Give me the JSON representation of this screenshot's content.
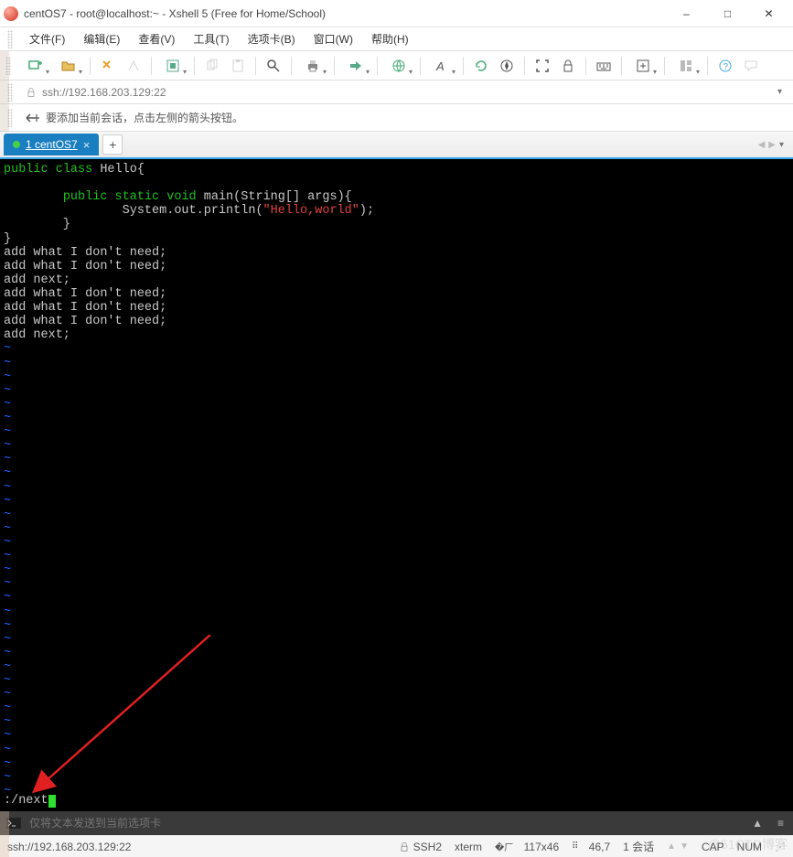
{
  "window": {
    "title": "centOS7 - root@localhost:~ - Xshell 5 (Free for Home/School)"
  },
  "menubar": {
    "items": [
      "文件(F)",
      "编辑(E)",
      "查看(V)",
      "工具(T)",
      "选项卡(B)",
      "窗口(W)",
      "帮助(H)"
    ]
  },
  "addressbar": {
    "url": "ssh://192.168.203.129:22"
  },
  "hintbar": {
    "text": "要添加当前会话，点击左侧的箭头按钮。"
  },
  "tab": {
    "label": "1 centOS7"
  },
  "terminal": {
    "lines": [
      {
        "t": "code",
        "segments": [
          [
            "kw-mod",
            "public"
          ],
          [
            "kw-plain",
            " "
          ],
          [
            "kw-mod",
            "class"
          ],
          [
            "kw-plain",
            " Hello{"
          ]
        ]
      },
      {
        "t": "blank"
      },
      {
        "t": "code",
        "segments": [
          [
            "kw-plain",
            "        "
          ],
          [
            "kw-mod",
            "public"
          ],
          [
            "kw-plain",
            " "
          ],
          [
            "kw-mod",
            "static"
          ],
          [
            "kw-plain",
            " "
          ],
          [
            "kw-mod",
            "void"
          ],
          [
            "kw-plain",
            " main(String[] args){"
          ]
        ]
      },
      {
        "t": "code",
        "segments": [
          [
            "kw-plain",
            "                System.out.println("
          ],
          [
            "str",
            "\"Hello,world\""
          ],
          [
            "kw-plain",
            ");"
          ]
        ]
      },
      {
        "t": "code",
        "segments": [
          [
            "kw-plain",
            "        }"
          ]
        ]
      },
      {
        "t": "code",
        "segments": [
          [
            "kw-plain",
            "}"
          ]
        ]
      },
      {
        "t": "code",
        "segments": [
          [
            "kw-plain",
            "add what I don't need;"
          ]
        ]
      },
      {
        "t": "code",
        "segments": [
          [
            "kw-plain",
            "add what I don't need;"
          ]
        ]
      },
      {
        "t": "code",
        "segments": [
          [
            "kw-plain",
            "add next;"
          ]
        ]
      },
      {
        "t": "code",
        "segments": [
          [
            "kw-plain",
            "add what I don't need;"
          ]
        ]
      },
      {
        "t": "code",
        "segments": [
          [
            "kw-plain",
            "add what I don't need;"
          ]
        ]
      },
      {
        "t": "code",
        "segments": [
          [
            "kw-plain",
            "add what I don't need;"
          ]
        ]
      },
      {
        "t": "code",
        "segments": [
          [
            "kw-plain",
            "add next;"
          ]
        ]
      }
    ],
    "tilde_count": 33,
    "command": ":/next"
  },
  "footer_input": {
    "placeholder": "仅将文本发送到当前选项卡"
  },
  "statusbar": {
    "conn": "ssh://192.168.203.129:22",
    "proto_icon": "SSH2",
    "term": "xterm",
    "size": "117x46",
    "cursor": "46,7",
    "sessions": "1 会话",
    "caps": "CAP",
    "num": "NUM"
  },
  "watermark": "@51CTO博客"
}
